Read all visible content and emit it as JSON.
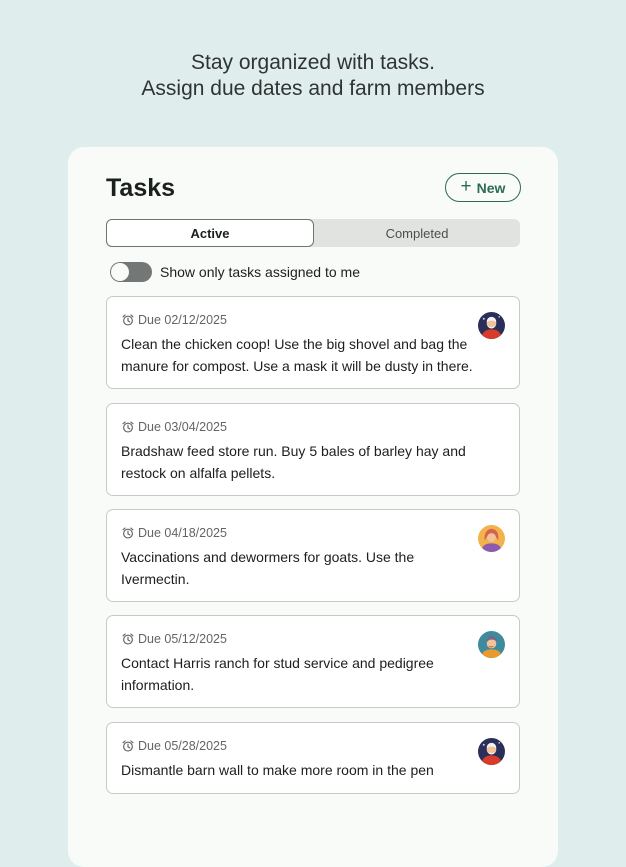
{
  "headline": {
    "line1": "Stay organized with tasks.",
    "line2": "Assign due dates and farm members"
  },
  "card": {
    "title": "Tasks",
    "new_label": "New",
    "tabs": [
      {
        "label": "Active",
        "selected": true
      },
      {
        "label": "Completed",
        "selected": false
      }
    ],
    "filter": {
      "label": "Show only tasks assigned to me",
      "on": false
    }
  },
  "tasks": [
    {
      "due": "Due 02/12/2025",
      "text": "Clean the chicken coop! Use the big shovel and bag the manure for compost. Use a mask it will be dusty in there.",
      "avatar": "avatar-farmer-red-icon"
    },
    {
      "due": "Due 03/04/2025",
      "text": "Bradshaw feed store run. Buy 5 bales of barley hay and restock on alfalfa pellets.",
      "avatar": null
    },
    {
      "due": "Due 04/18/2025",
      "text": "Vaccinations and dewormers for goats. Use the Ivermectin.",
      "avatar": "avatar-woman-icon"
    },
    {
      "due": "Due 05/12/2025",
      "text": "Contact Harris ranch for stud service and pedigree information.",
      "avatar": "avatar-man-icon"
    },
    {
      "due": "Due 05/28/2025",
      "text": "Dismantle barn wall to make more room in the pen",
      "avatar": "avatar-farmer-red-icon"
    }
  ],
  "colors": {
    "background": "#dfeeed",
    "card": "#f8fbf7",
    "accent": "#2d6b55"
  }
}
